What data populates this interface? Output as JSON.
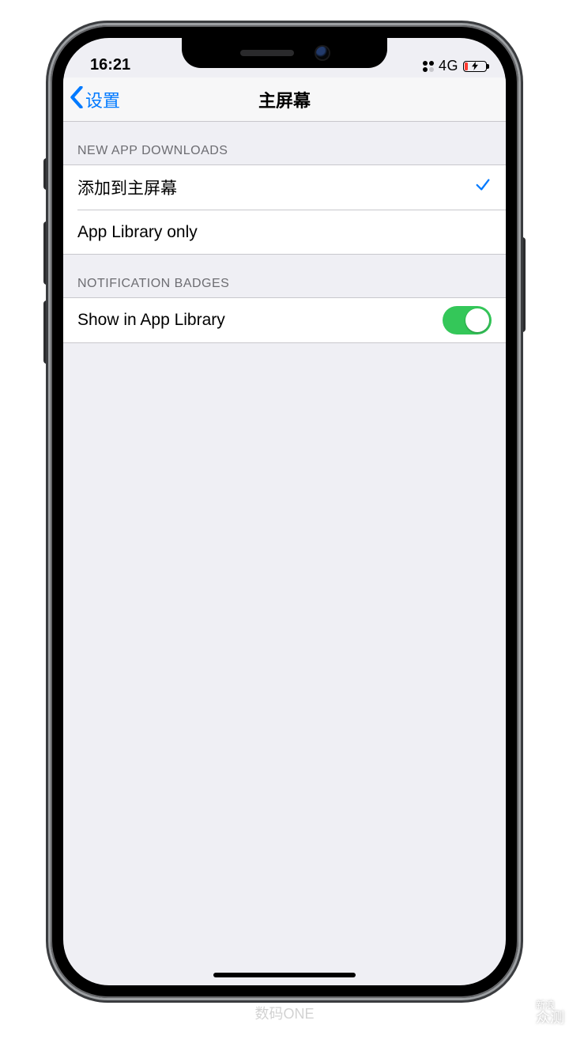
{
  "status": {
    "time": "16:21",
    "network": "4G"
  },
  "nav": {
    "back_label": "设置",
    "title": "主屏幕"
  },
  "sections": {
    "downloads": {
      "header": "NEW APP DOWNLOADS",
      "option_add": "添加到主屏幕",
      "option_library": "App Library only"
    },
    "badges": {
      "header": "NOTIFICATION BADGES",
      "show_label": "Show in App Library"
    }
  },
  "watermarks": {
    "corner_small": "新浪",
    "corner_big": "众测",
    "center": "数码ONE"
  }
}
